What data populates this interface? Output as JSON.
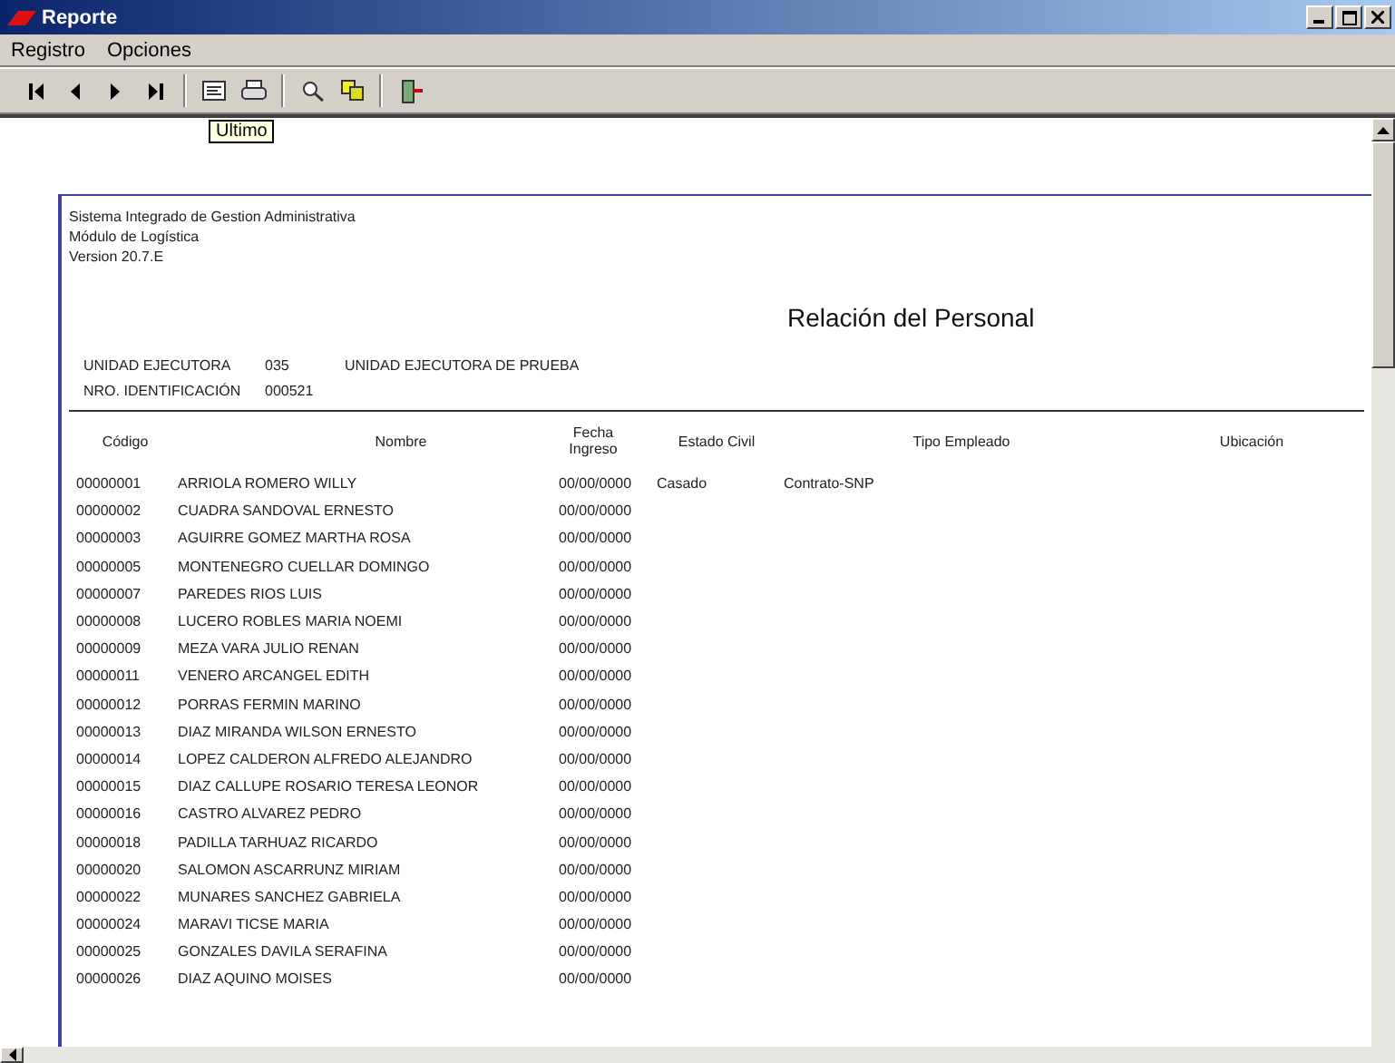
{
  "window": {
    "title": "Reporte"
  },
  "menu": [
    "Registro",
    "Opciones"
  ],
  "toolbar": [
    [
      {
        "kind": "first"
      },
      {
        "kind": "prev"
      },
      {
        "kind": "next"
      },
      {
        "kind": "last"
      }
    ],
    [
      {
        "kind": "setup"
      },
      {
        "kind": "print"
      }
    ],
    [
      {
        "kind": "find"
      },
      {
        "kind": "export"
      }
    ],
    [
      {
        "kind": "exit"
      }
    ]
  ],
  "tooltip": "Ultimo",
  "report": {
    "header_lines": [
      "Sistema Integrado de Gestion Administrativa",
      "Módulo de Logística",
      "Version 20.7.E"
    ],
    "title": "Relación del Personal",
    "info": [
      {
        "label": "UNIDAD EJECUTORA",
        "code": "035",
        "value": "UNIDAD EJECUTORA DE PRUEBA"
      },
      {
        "label": "NRO. IDENTIFICACIÓN",
        "code": "000521"
      }
    ],
    "columns": [
      "Código",
      "Nombre",
      "Fecha Ingreso",
      "Estado Civil",
      "Tipo Empleado",
      "Ubicación"
    ],
    "rows": [
      {
        "code": "00000001",
        "name": "ARRIOLA ROMERO WILLY",
        "date": "00/00/0000",
        "civil": "Casado",
        "type": "Contrato-SNP"
      },
      {
        "code": "00000002",
        "name": "CUADRA SANDOVAL ERNESTO",
        "date": "00/00/0000"
      },
      {
        "code": "00000003",
        "name": "AGUIRRE GOMEZ MARTHA ROSA",
        "date": "00/00/0000"
      },
      {
        "code": "00000005",
        "name": "MONTENEGRO CUELLAR DOMINGO",
        "date": "00/00/0000"
      },
      {
        "code": "00000007",
        "name": "PAREDES RIOS LUIS",
        "date": "00/00/0000"
      },
      {
        "code": "00000008",
        "name": "LUCERO ROBLES MARIA NOEMI",
        "date": "00/00/0000"
      },
      {
        "code": "00000009",
        "name": "MEZA VARA JULIO RENAN",
        "date": "00/00/0000"
      },
      {
        "code": "00000011",
        "name": "VENERO ARCANGEL EDITH",
        "date": "00/00/0000"
      },
      {
        "code": "00000012",
        "name": "PORRAS FERMIN MARINO",
        "date": "00/00/0000"
      },
      {
        "code": "00000013",
        "name": "DIAZ MIRANDA WILSON ERNESTO",
        "date": "00/00/0000"
      },
      {
        "code": "00000014",
        "name": "LOPEZ CALDERON ALFREDO ALEJANDRO",
        "date": "00/00/0000"
      },
      {
        "code": "00000015",
        "name": "DIAZ CALLUPE ROSARIO TERESA LEONOR",
        "date": "00/00/0000"
      },
      {
        "code": "00000016",
        "name": "CASTRO ALVAREZ PEDRO",
        "date": "00/00/0000"
      },
      {
        "code": "00000018",
        "name": "PADILLA TARHUAZ RICARDO",
        "date": "00/00/0000"
      },
      {
        "code": "00000020",
        "name": "SALOMON ASCARRUNZ MIRIAM",
        "date": "00/00/0000"
      },
      {
        "code": "00000022",
        "name": "MUNARES SANCHEZ GABRIELA",
        "date": "00/00/0000"
      },
      {
        "code": "00000024",
        "name": "MARAVI TICSE MARIA",
        "date": "00/00/0000"
      },
      {
        "code": "00000025",
        "name": "GONZALES DAVILA SERAFINA",
        "date": "00/00/0000"
      },
      {
        "code": "00000026",
        "name": "DIAZ AQUINO MOISES",
        "date": "00/00/0000"
      }
    ]
  }
}
